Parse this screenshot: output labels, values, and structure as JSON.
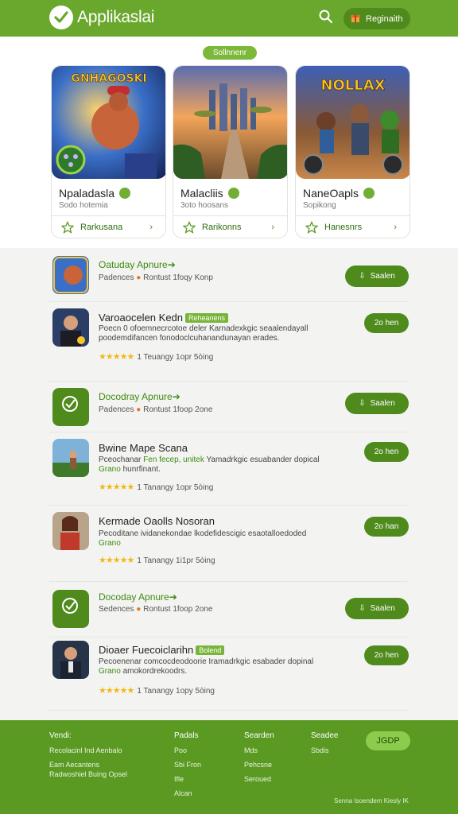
{
  "header": {
    "title": "Applikaslai",
    "register_label": "Reginaith",
    "colors": {
      "brand": "#6aa72d",
      "button": "#4f8a1c"
    }
  },
  "featured": {
    "pill": "Sollnnenr",
    "cards": [
      {
        "name": "Npaladasla",
        "sub": "Sodo hotemia",
        "button": "Rarkusana",
        "art_text": "GNHAGOSKI"
      },
      {
        "name": "Malacliis",
        "sub": "3oto hoosans",
        "button": "Rarikonns",
        "art_text": ""
      },
      {
        "name": "NaneOapls",
        "sub": "Sopikong",
        "button": "Hanesnrs",
        "art_text": "NOLLAX"
      }
    ]
  },
  "list": [
    {
      "title": "Oatuday Apnure",
      "arrow": "➔",
      "meta": "Padences",
      "meta2": "Rontust 1foqy Konp",
      "button": "Saalen",
      "variant": "compact"
    },
    {
      "title": "Varoaocelen Kedn",
      "tag": "Reheanens",
      "desc": "Poecn 0 ofoemnecrcotoe deler Karnadexkgic seaalendayall poodemdifancen fonodoclcuhanandunayan erades.",
      "stars": "★★★★★",
      "rating": "1 Teuangy 1opr 5òing",
      "button": "2o hen",
      "variant": "full"
    },
    {
      "title": "Docodray Apnure",
      "arrow": "➔",
      "meta": "Padences",
      "meta2": "Rontust 1foop 2one",
      "button": "Saalen",
      "variant": "compact"
    },
    {
      "title": "Bwine Mape Scana",
      "desc_pre": "Pceochanar",
      "desc_hl": "Fen fecep, unitek",
      "desc_post": "Yamadrkgic esuabander dopical",
      "desc_line2_hl": "Grano",
      "desc_line2": "hunrfinant.",
      "stars": "★★★★★",
      "rating": "1 Tanangy 1opr 5òing",
      "button": "2o hen",
      "variant": "mixed"
    },
    {
      "title": "Kermade Oaolls Nosoran",
      "desc_pre": "Pecoditane ividanekondae lkodefidescigic esaotalloedoded",
      "desc_line2_hl": "Grano",
      "desc_line2": "",
      "stars": "★★★★★",
      "rating": "1 Tanangy 1i1pr 5òing",
      "button": "2o han",
      "variant": "mixed2"
    },
    {
      "title": "Docoday Apnure",
      "arrow": "➔",
      "meta": "Sedences",
      "meta2": "Rontust 1foop 2one",
      "button": "Saalen",
      "variant": "compact"
    },
    {
      "title": "Dioaer Fuecoiclarihn",
      "tag": "Bolend",
      "desc": "Pecoenenar comcocdeodoorie Iramadrkgic esabader dopinal",
      "desc_line2_hl": "Grano",
      "desc_line2": "amokordrekoodrs.",
      "stars": "★★★★★",
      "rating": "1 Tanangy 1opy 5òing",
      "button": "2o hen",
      "variant": "mixed"
    }
  ],
  "footer": {
    "col1": {
      "heading": "Vendi:",
      "items": [
        "Recolacinl Ind Aenbalo",
        "Eam Aecantens",
        "Radwoshiel Buing Opsel"
      ]
    },
    "col2": {
      "heading": "Padals",
      "items": [
        "Poo",
        "Sbi Fron",
        "Ifle",
        "Alcan"
      ]
    },
    "col3": {
      "heading": "Searden",
      "items": [
        "Mds",
        "Pehcsne",
        "Seroued"
      ]
    },
    "col4": {
      "heading": "Seadee",
      "items": [
        "Sbdis"
      ]
    },
    "button": "JGDP",
    "copyright": "Senna Isoendem Kiesly IK"
  }
}
